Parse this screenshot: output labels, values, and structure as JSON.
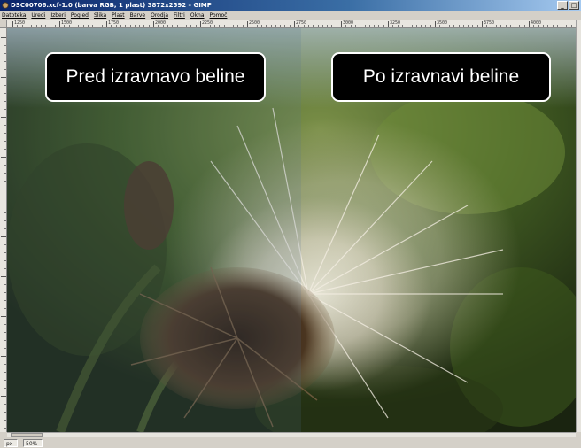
{
  "window": {
    "title": "DSC00706.xcf-1.0 (barva RGB, 1 plast) 3872x2592 – GIMP",
    "icon": "gimp-wilber-icon",
    "buttons": [
      "minimize-icon",
      "maximize-icon"
    ]
  },
  "menubar": {
    "items": [
      "Datoteka",
      "Uredi",
      "Izberi",
      "Pogled",
      "Slika",
      "Plast",
      "Barve",
      "Orodja",
      "Filtri",
      "Okna",
      "Pomoč"
    ]
  },
  "ruler": {
    "top_labels": [
      "1250",
      "1500",
      "1750",
      "2000",
      "2250",
      "2500",
      "2750",
      "3000",
      "3250",
      "3500",
      "3750",
      "4000"
    ]
  },
  "canvas": {
    "label_before": "Pred izravnavo beline",
    "label_after": "Po izravnavi beline",
    "colors": {
      "label_bg": "#000000",
      "label_border": "#ffffff",
      "label_text": "#ffffff",
      "foliage_dark": "#1f2a12",
      "foliage_mid": "#4d6a26",
      "seed_fluff": "#f2eadf",
      "flower_head": "#3b2a1a"
    }
  },
  "statusbar": {
    "unit": "px",
    "zoom": "50%"
  }
}
